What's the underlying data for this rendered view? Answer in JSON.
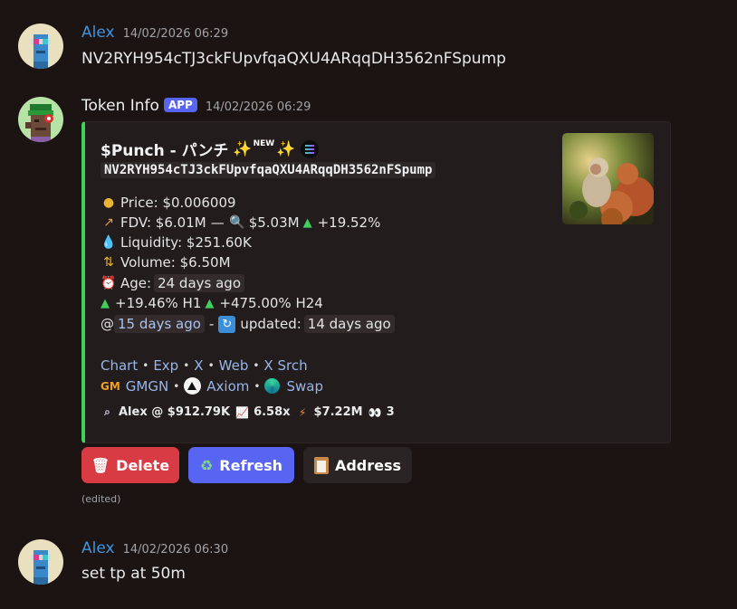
{
  "messages": [
    {
      "author": "Alex",
      "timestamp": "14/02/2026 06:29",
      "text": "NV2RYH954cTJ3ckFUpvfqaQXU4ARqqDH3562nFSpump"
    },
    {
      "author": "Token Info",
      "badge": "APP",
      "timestamp": "14/02/2026 06:29"
    },
    {
      "author": "Alex",
      "timestamp": "14/02/2026 06:30",
      "text": "set tp at 50m"
    }
  ],
  "embed": {
    "accent_color": "#3fd05d",
    "title": "$Punch - パンチ",
    "title_tag": "NEW",
    "contract": "NV2RYH954cTJ3ckFUpvfqaQXU4ARqqDH3562nFSpump",
    "price": {
      "icon": "coin-icon",
      "label": "Price:",
      "value": "$0.006009"
    },
    "fdv": {
      "icon": "chart-up-icon",
      "label": "FDV:",
      "value": "$6.01M",
      "sep": "—",
      "icon2": "magnifier-icon",
      "value2": "$5.03M",
      "change": "+19.52%"
    },
    "liquidity": {
      "icon": "droplet-icon",
      "label": "Liquidity:",
      "value": "$251.60K"
    },
    "volume": {
      "icon": "exchange-icon",
      "label": "Volume:",
      "value": "$6.50M"
    },
    "age": {
      "icon": "alarm-clock-icon",
      "label": "Age:",
      "value": "24 days ago"
    },
    "changes": {
      "h1_value": "+19.46%",
      "h1_label": "H1",
      "h24_value": "+475.00%",
      "h24_label": "H24"
    },
    "created": {
      "prefix": "@",
      "value": "15 days ago",
      "sep": "-",
      "updated_label": "updated:",
      "updated_value": "14 days ago"
    },
    "links": [
      "Chart",
      "Exp",
      "X",
      "Web",
      "X Srch"
    ],
    "platforms": {
      "gm_badge": "GM",
      "gmgn": "GMGN",
      "axiom": "Axiom",
      "swap": "Swap"
    },
    "caller": {
      "text": "Alex @ $912.79K",
      "multiple": "6.58x",
      "peak": "$7.22M",
      "views": "3"
    }
  },
  "buttons": {
    "delete": "Delete",
    "refresh": "Refresh",
    "address": "Address"
  },
  "edited_label": "(edited)"
}
